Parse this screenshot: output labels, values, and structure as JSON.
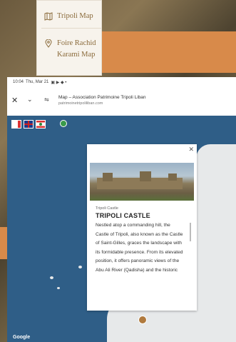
{
  "menu": {
    "items": [
      {
        "label": "Tripoli Map",
        "icon": "map-icon"
      },
      {
        "label": "Foire Rachid Karami Map",
        "icon": "location-pin-icon"
      }
    ]
  },
  "phone": {
    "status_time": "10:04",
    "status_date": "Thu, Mar 21",
    "browser_title": "Map – Association Patrimoine Tripoli Liban",
    "browser_url": "patrimoinetripoliliban.com"
  },
  "card": {
    "kicker": "Tripoli Castle",
    "title": "TRIPOLI CASTLE",
    "body": "Nestled atop a commanding hill, the Castle of Tripoli, also known as the Castle of Saint-Gilles, graces the landscape with its formidable presence. From its elevated position, it offers panoramic views of the Abu Ali River (Qadisha) and the historic"
  },
  "map": {
    "attribution": "Google"
  },
  "colors": {
    "sea": "#2f5e87",
    "land": "#e7e9ea",
    "accent": "#d88a4a",
    "menu_text": "#8a6a3a"
  }
}
